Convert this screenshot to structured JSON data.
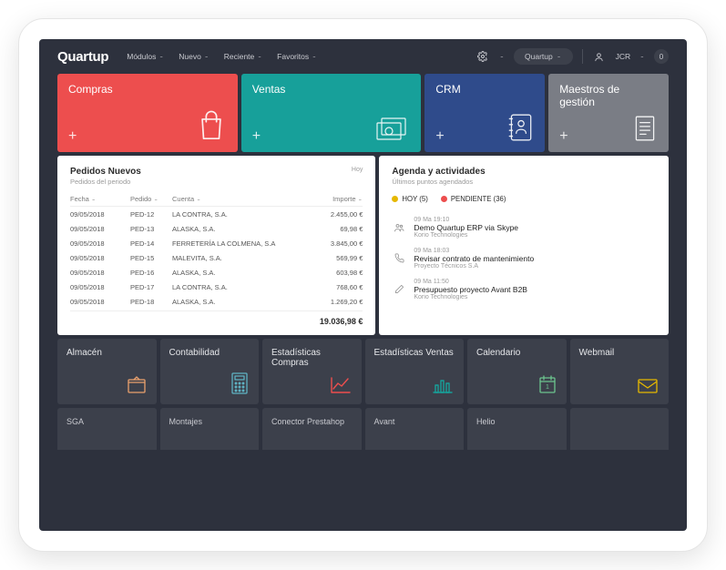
{
  "header": {
    "brand": "Quartup",
    "nav": [
      "Módulos",
      "Nuevo",
      "Reciente",
      "Favoritos"
    ],
    "org": "Quartup",
    "user": "JCR",
    "notif_count": "0"
  },
  "tiles_top": [
    {
      "label": "Compras",
      "color": "red"
    },
    {
      "label": "Ventas",
      "color": "teal"
    },
    {
      "label": "CRM",
      "color": "blue"
    },
    {
      "label": "Maestros de gestión",
      "color": "grey"
    }
  ],
  "orders": {
    "title": "Pedidos Nuevos",
    "subtitle": "Pedidos del periodo",
    "link": "Hoy",
    "columns": {
      "date": "Fecha",
      "order": "Pedido",
      "account": "Cuenta",
      "amount": "Importe"
    },
    "rows": [
      {
        "date": "09/05/2018",
        "order": "PED-12",
        "account": "LA CONTRA, S.A.",
        "amount": "2.455,00 €"
      },
      {
        "date": "09/05/2018",
        "order": "PED-13",
        "account": "ALASKA, S.A.",
        "amount": "69,98 €"
      },
      {
        "date": "09/05/2018",
        "order": "PED-14",
        "account": "FERRETERÍA LA COLMENA, S.A",
        "amount": "3.845,00 €"
      },
      {
        "date": "09/05/2018",
        "order": "PED-15",
        "account": "MALEVITA, S.A.",
        "amount": "569,99 €"
      },
      {
        "date": "09/05/2018",
        "order": "PED-16",
        "account": "ALASKA, S.A.",
        "amount": "603,98 €"
      },
      {
        "date": "09/05/2018",
        "order": "PED-17",
        "account": "LA CONTRA, S.A.",
        "amount": "768,60 €"
      },
      {
        "date": "09/05/2018",
        "order": "PED-18",
        "account": "ALASKA, S.A.",
        "amount": "1.269,20 €"
      }
    ],
    "total": "19.036,98 €"
  },
  "agenda": {
    "title": "Agenda y actividades",
    "subtitle": "Últimos puntos agendados",
    "tabs": {
      "today": "HOY (5)",
      "pending": "PENDIENTE (36)"
    },
    "items": [
      {
        "time": "09 Ma 19:10",
        "title": "Demo Quartup ERP via Skype",
        "org": "Korio Technologies",
        "icon": "users-icon"
      },
      {
        "time": "09 Ma 18:03",
        "title": "Revisar contrato de mantenimiento",
        "org": "Proyecto Técnicos S.A",
        "icon": "phone-icon"
      },
      {
        "time": "09 Ma 11:50",
        "title": "Presupuesto proyecto Avant B2B",
        "org": "Korio Technologies",
        "icon": "pencil-icon"
      }
    ]
  },
  "tiles_sm": [
    {
      "label": "Almacén",
      "icon": "box",
      "color": "#e8a06d"
    },
    {
      "label": "Contabilidad",
      "icon": "calc",
      "color": "#5fb3c3"
    },
    {
      "label": "Estadísticas Compras",
      "icon": "chartup",
      "color": "#ed4e4e"
    },
    {
      "label": "Estadísticas Ventas",
      "icon": "bars",
      "color": "#17a09a"
    },
    {
      "label": "Calendario",
      "icon": "cal",
      "color": "#6cc48e"
    },
    {
      "label": "Webmail",
      "icon": "mail",
      "color": "#e6b800"
    }
  ],
  "tiles_sm2": [
    {
      "label": "SGA"
    },
    {
      "label": "Montajes"
    },
    {
      "label": "Conector Prestahop"
    },
    {
      "label": "Avant"
    },
    {
      "label": "Helio"
    },
    {
      "label": ""
    }
  ]
}
